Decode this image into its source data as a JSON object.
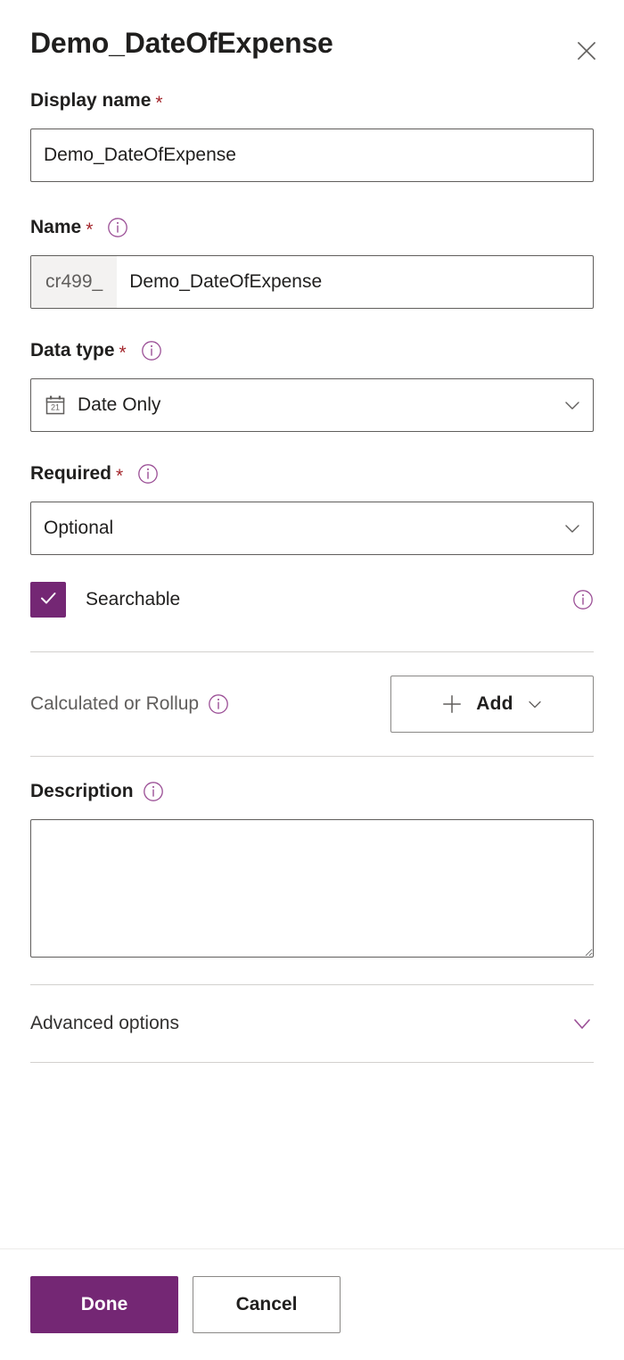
{
  "panel": {
    "title": "Demo_DateOfExpense",
    "close_icon": "close-icon"
  },
  "fields": {
    "display_name": {
      "label": "Display name",
      "required_marker": "*",
      "value": "Demo_DateOfExpense",
      "placeholder": ""
    },
    "name": {
      "label": "Name",
      "required_marker": "*",
      "prefix": "cr499_",
      "value": "Demo_DateOfExpense",
      "placeholder": "",
      "info_icon": "info-icon"
    },
    "data_type": {
      "label": "Data type",
      "required_marker": "*",
      "value": "Date Only",
      "value_icon": "calendar-icon",
      "caret_icon": "chevron-down-icon",
      "info_icon": "info-icon"
    },
    "required": {
      "label": "Required",
      "required_marker": "*",
      "value": "Optional",
      "caret_icon": "chevron-down-icon",
      "info_icon": "info-icon"
    },
    "searchable": {
      "label": "Searchable",
      "checked": true,
      "check_icon": "checkmark-icon",
      "info_icon": "info-icon"
    },
    "calculated_or_rollup": {
      "label": "Calculated or Rollup",
      "info_icon": "info-icon",
      "add_button": {
        "label": "Add",
        "plus_icon": "plus-icon",
        "caret_icon": "chevron-down-icon"
      }
    },
    "description": {
      "label": "Description",
      "value": "",
      "placeholder": "",
      "info_icon": "info-icon",
      "resize_handle": "resize-grip-icon"
    },
    "advanced_options": {
      "label": "Advanced options",
      "caret_icon": "chevron-down-icon"
    }
  },
  "footer": {
    "done_label": "Done",
    "cancel_label": "Cancel"
  },
  "colors": {
    "accent": "#742774",
    "required_star": "#a4262c",
    "border": "#605e5c",
    "divider": "#d2d0ce",
    "prefix_bg": "#f3f2f1"
  }
}
